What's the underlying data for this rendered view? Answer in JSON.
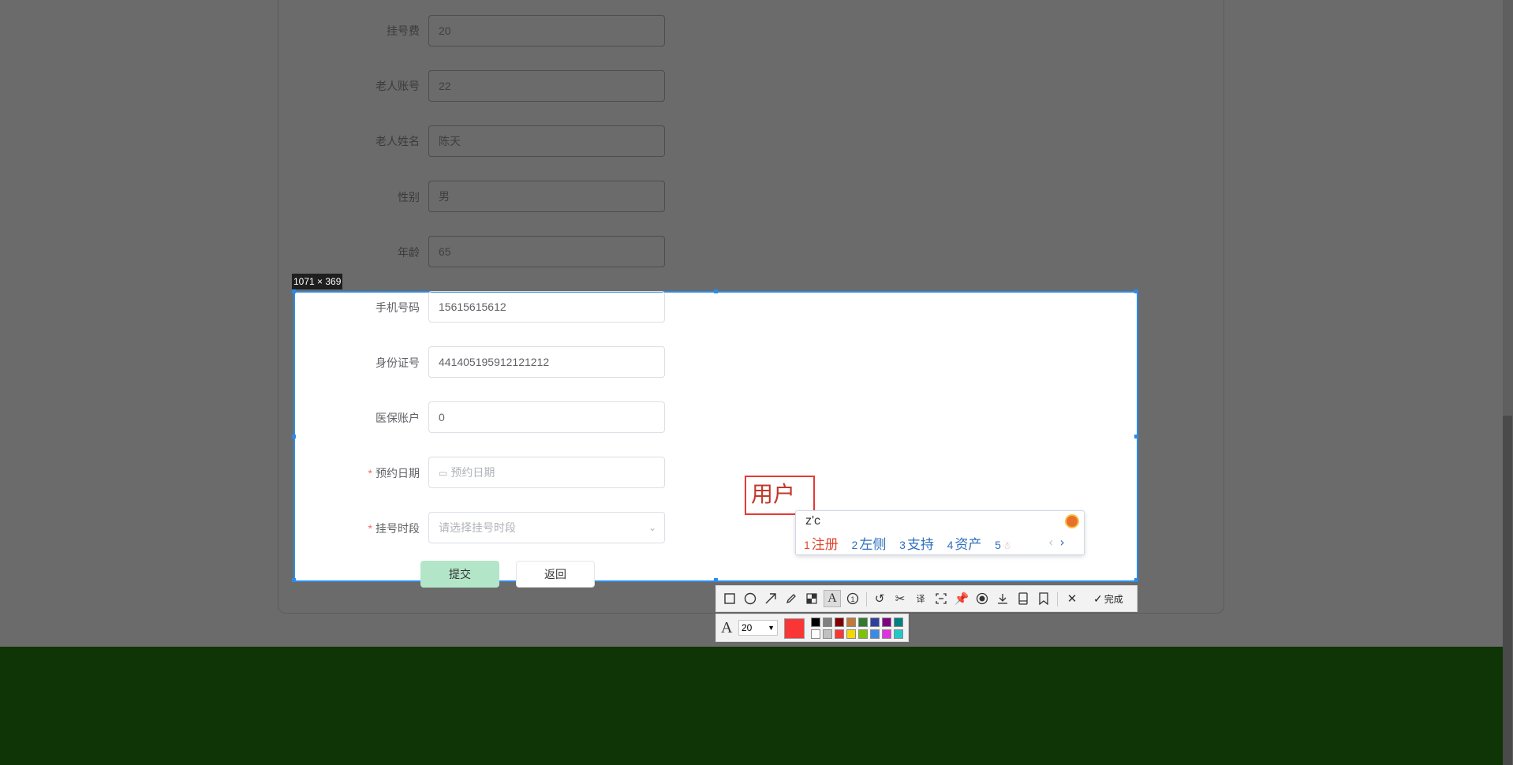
{
  "form": {
    "fee_label": "挂号费",
    "fee_value": "20",
    "account_label": "老人账号",
    "account_value": "22",
    "name_label": "老人姓名",
    "name_value": "陈天",
    "gender_label": "性别",
    "gender_value": "男",
    "age_label": "年龄",
    "age_value": "65",
    "phone_label": "手机号码",
    "phone_value": "15615615612",
    "id_label": "身份证号",
    "id_value": "441405195912121212",
    "insurance_label": "医保账户",
    "insurance_value": "0",
    "date_label": "预约日期",
    "date_placeholder": "预约日期",
    "slot_label": "挂号时段",
    "slot_placeholder": "请选择挂号时段",
    "required_mark": "*",
    "submit_label": "提交",
    "return_label": "返回"
  },
  "capture": {
    "size_label": "1071 × 369"
  },
  "annotation": {
    "text": "用户"
  },
  "ime": {
    "input": "z'c",
    "candidates": [
      {
        "num": "1",
        "text": "注册"
      },
      {
        "num": "2",
        "text": "左侧"
      },
      {
        "num": "3",
        "text": "支持"
      },
      {
        "num": "4",
        "text": "资产"
      },
      {
        "num": "5",
        "text": ""
      }
    ],
    "prev": "‹",
    "next": "›"
  },
  "toolbar": {
    "done_label": "完成",
    "icons": [
      "rectangle-icon",
      "ellipse-icon",
      "arrow-icon",
      "pencil-icon",
      "mosaic-icon",
      "text-icon",
      "number-icon",
      "undo-icon",
      "scissors-icon",
      "translate-icon",
      "ocr-icon",
      "pin-icon",
      "record-icon",
      "download-icon",
      "long-screenshot-icon",
      "bookmark-icon",
      "close-icon",
      "check-icon"
    ]
  },
  "text_options": {
    "font_size": "20",
    "current_color": "#fa3535",
    "palette_top": [
      "#000000",
      "#808080",
      "#800000",
      "#c07a35",
      "#2f7a2f",
      "#2f3f9f",
      "#800080",
      "#008080"
    ],
    "palette_bottom": [
      "#ffffff",
      "#c0c0c0",
      "#fa3535",
      "#f5d800",
      "#7cc400",
      "#3a8be6",
      "#e030e0",
      "#20c8c8"
    ]
  },
  "colors": {
    "overlay": "#6b6b6b",
    "footer_green": "#0f3406",
    "selection_border": "#2c8be6",
    "submit_bg": "#b3e6c9"
  }
}
